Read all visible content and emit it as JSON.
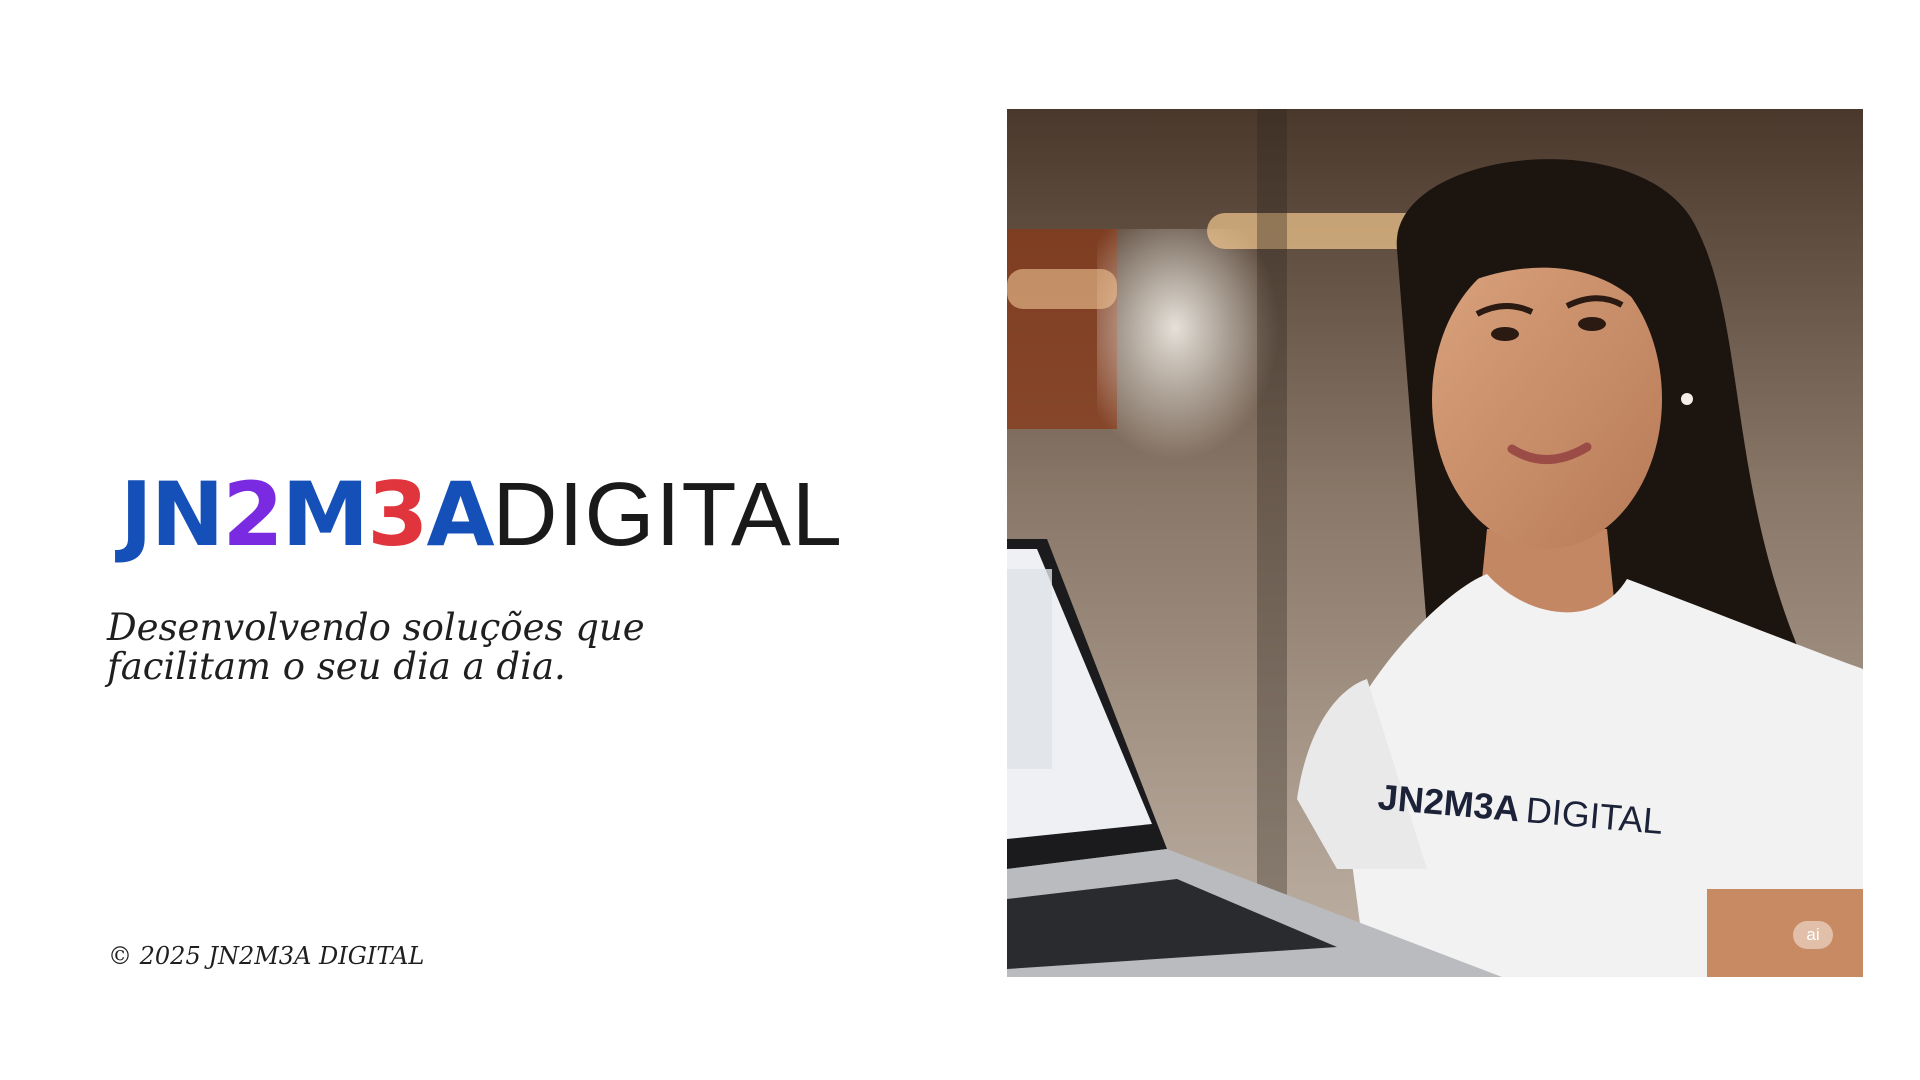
{
  "logo": {
    "parts": [
      {
        "text": "JN",
        "color": "#1450b8"
      },
      {
        "text": "2",
        "color": "#7a2be2"
      },
      {
        "text": "M",
        "color": "#1450b8"
      },
      {
        "text": "3",
        "color": "#e0353c"
      },
      {
        "text": "A",
        "color": "#1450b8"
      }
    ],
    "suffix": "DIGITAL",
    "suffix_color": "#1a1a1a"
  },
  "tagline": {
    "line1": "Desenvolvendo soluções que",
    "line2": "facilitam o seu dia a dia."
  },
  "copyright": "© 2025 JN2M3A DIGITAL",
  "photo": {
    "shirt_text_bold": "JN2M3A",
    "shirt_text_light": "DIGITAL",
    "ai_badge": "ai",
    "icons": [
      "laptop-icon"
    ]
  }
}
